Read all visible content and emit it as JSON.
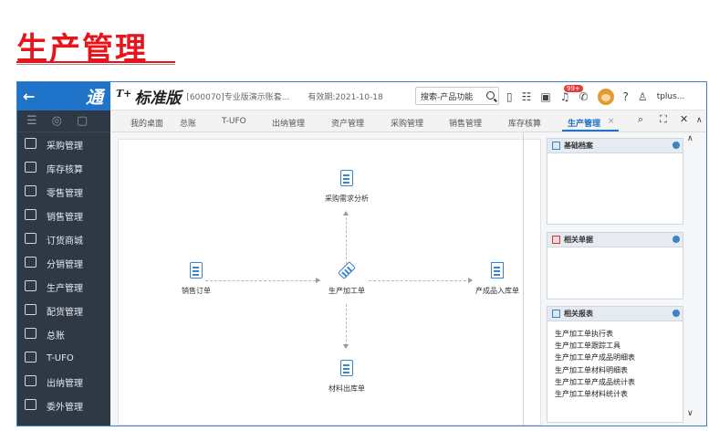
{
  "banner": {
    "title": "生产管理"
  },
  "sidebar": {
    "logo": "通",
    "back_icon": "←",
    "items": [
      {
        "label": "采购管理",
        "icon": "purchase-icon"
      },
      {
        "label": "库存核算",
        "icon": "inventory-icon"
      },
      {
        "label": "零售管理",
        "icon": "retail-icon"
      },
      {
        "label": "销售管理",
        "icon": "sales-icon"
      },
      {
        "label": "订货商城",
        "icon": "mall-icon"
      },
      {
        "label": "分销管理",
        "icon": "distribution-icon"
      },
      {
        "label": "生产管理",
        "icon": "production-icon"
      },
      {
        "label": "配货管理",
        "icon": "allocation-icon"
      },
      {
        "label": "总账",
        "icon": "ledger-icon"
      },
      {
        "label": "T-UFO",
        "icon": "ufo-icon"
      },
      {
        "label": "出纳管理",
        "icon": "cashier-icon"
      },
      {
        "label": "委外管理",
        "icon": "outsource-icon"
      }
    ]
  },
  "header": {
    "brand_sup": "T+",
    "brand": "标准版",
    "account": "[600070]专业版演示账套...",
    "expire": "有效期:2021-10-18",
    "search_placeholder": "搜索-产品功能",
    "badge": "99+",
    "user": "tplus..."
  },
  "tabs": [
    {
      "label": "我的桌面"
    },
    {
      "label": "总账"
    },
    {
      "label": "T-UFO"
    },
    {
      "label": "出纳管理"
    },
    {
      "label": "资产管理"
    },
    {
      "label": "采购管理"
    },
    {
      "label": "销售管理"
    },
    {
      "label": "库存核算"
    },
    {
      "label": "生产管理",
      "active": true,
      "close": "×"
    }
  ],
  "flow": {
    "purchase_analysis": "采购需求分析",
    "sales_order": "销售订单",
    "production_order": "生产加工单",
    "finished_inbound": "产成品入库单",
    "material_outbound": "材料出库单"
  },
  "panels": {
    "basic": {
      "title": "基础档案"
    },
    "related_docs": {
      "title": "相关单据"
    },
    "related_reports": {
      "title": "相关报表",
      "items": [
        "生产加工单执行表",
        "生产加工单跟踪工具",
        "生产加工单产成品明细表",
        "生产加工单材料明细表",
        "生产加工单产成品统计表",
        "生产加工单材料统计表"
      ]
    }
  },
  "colors": {
    "banner_red": "#e8141b",
    "primary_blue": "#1f73c8",
    "sidebar_bg": "#2f3845"
  }
}
